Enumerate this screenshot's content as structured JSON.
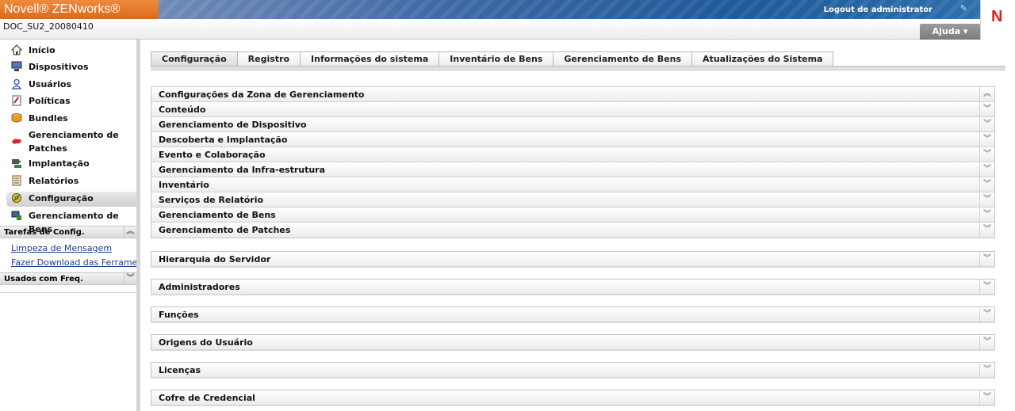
{
  "header": {
    "brand": "Novell® ZENworks®",
    "logout": "Logout de administrator",
    "zone": "DOC_SU2_20080410",
    "help": "Ajuda ▾",
    "logo_letter": "N"
  },
  "sidebar": {
    "items": [
      {
        "label": "Início",
        "icon": "home-icon"
      },
      {
        "label": "Dispositivos",
        "icon": "devices-icon"
      },
      {
        "label": "Usuários",
        "icon": "users-icon"
      },
      {
        "label": "Políticas",
        "icon": "policies-icon"
      },
      {
        "label": "Bundles",
        "icon": "bundles-icon"
      },
      {
        "label": "Gerenciamento de Patches",
        "icon": "patches-icon"
      },
      {
        "label": "Implantação",
        "icon": "deployment-icon"
      },
      {
        "label": "Relatórios",
        "icon": "reports-icon"
      },
      {
        "label": "Configuração",
        "icon": "configuration-icon",
        "selected": true
      },
      {
        "label": "Gerenciamento de Bens",
        "icon": "asset-management-icon"
      }
    ],
    "tasks_title": "Tarefas de Config.",
    "tasks": [
      "Limpeza de Mensagem",
      "Fazer Download das Ferramentas"
    ],
    "frequent_title": "Usados com Freq."
  },
  "tabs": [
    {
      "label": "Configuração",
      "active": true
    },
    {
      "label": "Registro"
    },
    {
      "label": "Informações do sistema"
    },
    {
      "label": "Inventário de Bens"
    },
    {
      "label": "Gerenciamento de Bens"
    },
    {
      "label": "Atualizações do Sistema"
    }
  ],
  "zone_settings": {
    "title": "Configurações da Zona de Gerenciamento",
    "items": [
      "Conteúdo",
      "Gerenciamento de Dispositivo",
      "Descoberta e Implantação",
      "Evento e Colaboração",
      "Gerenciamento da Infra-estrutura",
      "Inventário",
      "Serviços de Relatório",
      "Gerenciamento de Bens",
      "Gerenciamento de Patches"
    ]
  },
  "panels": [
    "Hierarquia do Servidor",
    "Administradores",
    "Funções",
    "Origens do Usuário",
    "Licenças",
    "Cofre de Credencial"
  ],
  "colors": {
    "brand_orange": "#e2742a",
    "banner_blue": "#2a63a2",
    "link": "#1a3d8f",
    "logo_red": "#dd1f26"
  }
}
